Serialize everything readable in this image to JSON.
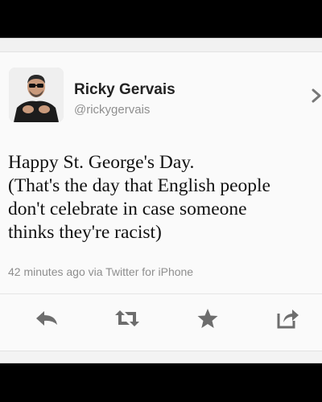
{
  "profile": {
    "display_name": "Ricky Gervais",
    "username": "@rickygervais"
  },
  "tweet": {
    "lines": [
      "Happy St. George's Day.",
      "(That's the day that English people",
      "don't celebrate in case someone",
      "thinks they're racist)"
    ],
    "meta": "42 minutes ago via Twitter for iPhone"
  },
  "actions": {
    "reply": "reply-icon",
    "retweet": "retweet-icon",
    "favorite": "star-icon",
    "share": "share-icon"
  },
  "colors": {
    "background": "#000000",
    "card": "#fafafa",
    "icon": "#6d6d6d",
    "meta_text": "#8e8e8e"
  }
}
